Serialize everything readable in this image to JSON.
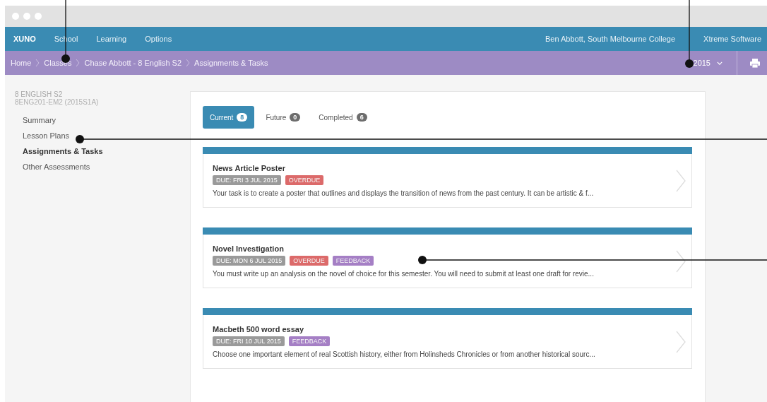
{
  "nav": {
    "logo": "XUNO",
    "items": [
      "School",
      "Learning",
      "Options"
    ],
    "user": "Ben Abbott, South Melbourne College",
    "vendor": "Xtreme Software"
  },
  "breadcrumb": [
    "Home",
    "Classes",
    "Chase Abbott - 8 English S2",
    "Assignments & Tasks"
  ],
  "year": "2015",
  "sidebar": {
    "title": "8 ENGLISH S2",
    "code": "8ENG201-EM2 (2015S1A)",
    "items": [
      {
        "label": "Summary",
        "selected": false
      },
      {
        "label": "Lesson Plans",
        "selected": false
      },
      {
        "label": "Assignments & Tasks",
        "selected": true
      },
      {
        "label": "Other Assessments",
        "selected": false
      }
    ]
  },
  "tabs": [
    {
      "label": "Current",
      "count": "8",
      "selected": true
    },
    {
      "label": "Future",
      "count": "0",
      "selected": false
    },
    {
      "label": "Completed",
      "count": "6",
      "selected": false
    }
  ],
  "tasks": [
    {
      "title": "News Article Poster",
      "tags": [
        {
          "kind": "due",
          "text": "DUE: FRI 3 JUL 2015"
        },
        {
          "kind": "overdue",
          "text": "OVERDUE"
        }
      ],
      "description": "Your task is to create a poster that outlines and displays the transition of news from the past century. It can be artistic & f..."
    },
    {
      "title": "Novel Investigation",
      "tags": [
        {
          "kind": "due",
          "text": "DUE: MON 6 JUL 2015"
        },
        {
          "kind": "overdue",
          "text": "OVERDUE"
        },
        {
          "kind": "feedback",
          "text": "FEEDBACK"
        }
      ],
      "description": "You must write up an analysis on the novel of choice for this semester. You will need to submit at least one draft for revie..."
    },
    {
      "title": "Macbeth 500 word essay",
      "tags": [
        {
          "kind": "due",
          "text": "DUE: FRI 10 JUL 2015"
        },
        {
          "kind": "feedback",
          "text": "FEEDBACK"
        }
      ],
      "description": "Choose one important element of real Scottish history, either from Holinsheds Chronicles or from another historical sourc..."
    }
  ]
}
